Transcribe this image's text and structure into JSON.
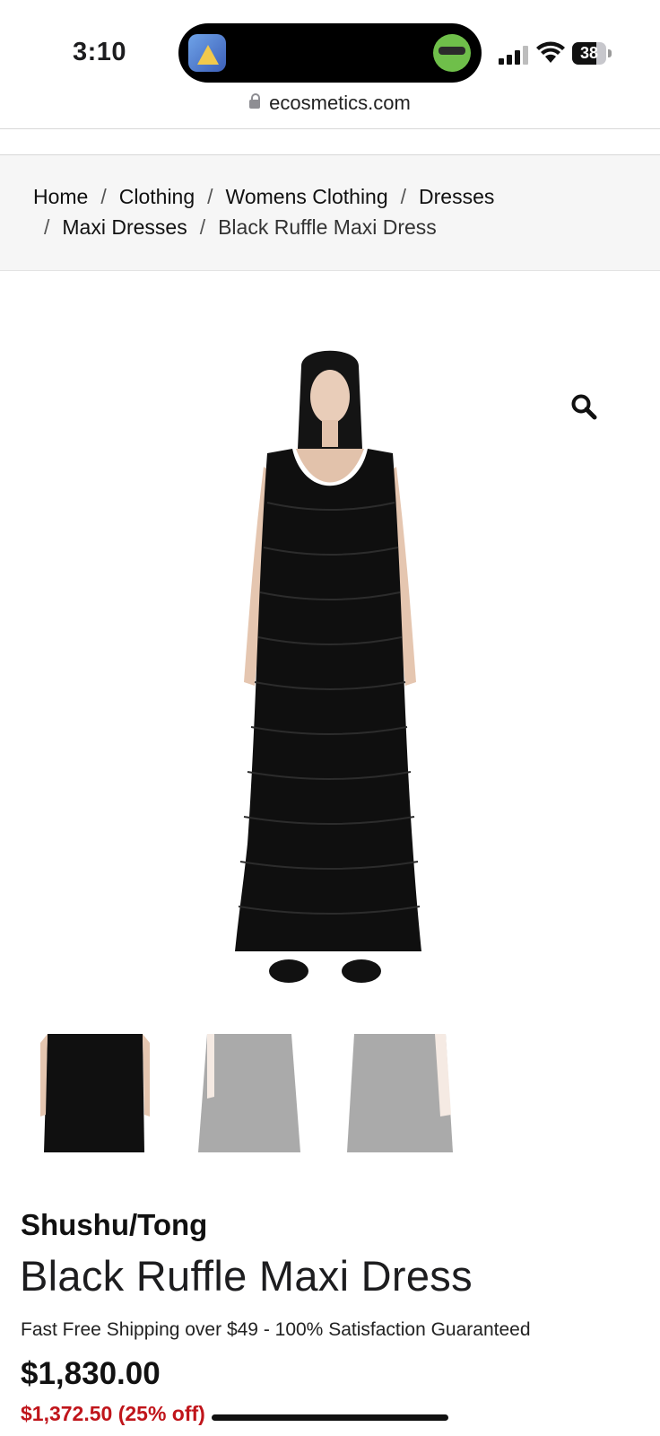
{
  "status_bar": {
    "time": "3:10",
    "battery": "38"
  },
  "browser": {
    "url": "ecosmetics.com"
  },
  "breadcrumb": {
    "separator": "/",
    "items": [
      "Home",
      "Clothing",
      "Womens Clothing",
      "Dresses",
      "Maxi Dresses",
      "Black Ruffle Maxi Dress"
    ]
  },
  "product": {
    "brand": "Shushu/Tong",
    "title": "Black Ruffle Maxi Dress",
    "shipping_note": "Fast Free Shipping over $49 - 100% Satisfaction Guaranteed",
    "price": "$1,830.00",
    "sale_price": "$1,372.50 (25% off)",
    "thumbnail_count": 3,
    "selected_thumbnail": 1
  },
  "colors": {
    "sale_red": "#c0151b",
    "text_dark": "#1d1d1f",
    "breadcrumb_bg": "#f6f6f6"
  },
  "icons": {
    "zoom": "magnifier-icon",
    "secure": "lock-icon"
  }
}
